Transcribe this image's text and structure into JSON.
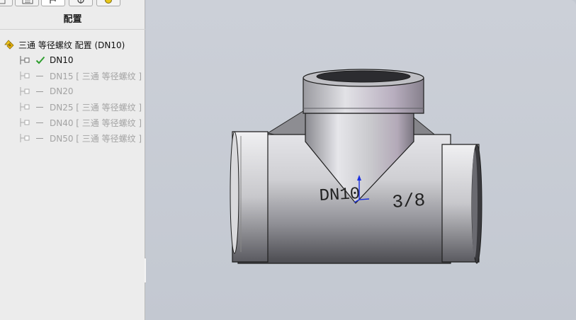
{
  "panel": {
    "title": "配置",
    "tabs": [
      {
        "icon": "feature-tree-icon"
      },
      {
        "icon": "property-manager-icon"
      },
      {
        "icon": "configuration-manager-icon",
        "active": true
      },
      {
        "icon": "dimxpert-icon"
      },
      {
        "icon": "display-manager-icon"
      }
    ],
    "root": {
      "label": "三通 等径螺纹 配置 (DN10)"
    },
    "configs": [
      {
        "label": "DN10",
        "active": true
      },
      {
        "label": "DN15 [ 三通 等径螺纹 ]",
        "active": false
      },
      {
        "label": "DN20",
        "active": false
      },
      {
        "label": "DN25 [ 三通 等径螺纹 ]",
        "active": false
      },
      {
        "label": "DN40 [ 三通 等径螺纹 ]",
        "active": false
      },
      {
        "label": "DN50 [ 三通 等径螺纹 ]",
        "active": false
      }
    ]
  },
  "model": {
    "engraving_left": "DN10",
    "engraving_right": "3/8"
  },
  "colors": {
    "active_check": "#2f9e2f",
    "triad_axis": "#1a2fe0",
    "viewport_bg": "#c4c9d2"
  }
}
